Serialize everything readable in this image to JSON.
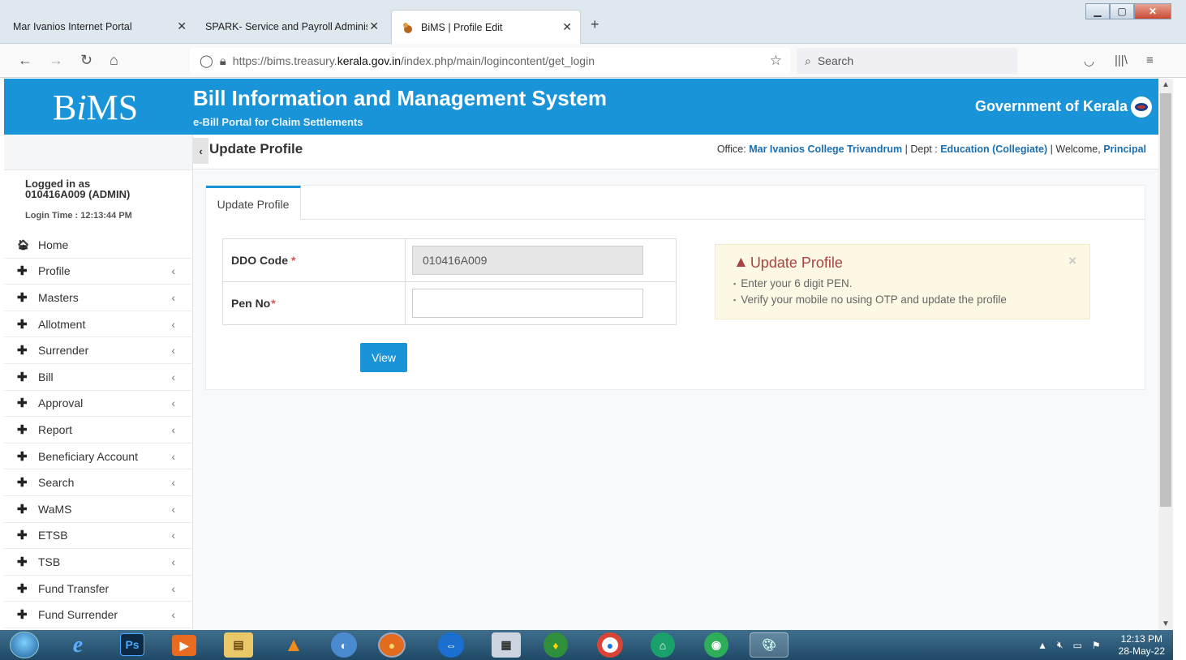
{
  "browser": {
    "tabs": [
      {
        "title": "Mar Ivanios Internet Portal",
        "active": false
      },
      {
        "title": "SPARK- Service and Payroll Adminis",
        "active": false
      },
      {
        "title": "BiMS | Profile Edit",
        "active": true
      }
    ],
    "url_prefix": "https://bims.treasury.",
    "url_domain": "kerala.gov.in",
    "url_path": "/index.php/main/logincontent/get_login",
    "search_placeholder": "Search"
  },
  "header": {
    "logo_b": "B",
    "logo_i": "i",
    "logo_ms": "MS",
    "title": "Bill Information and Management System",
    "subtitle": "e-Bill Portal for Claim Settlements",
    "gov": "Government of Kerala"
  },
  "user": {
    "logged_in_label": "Logged in as",
    "logged_in_id": "010416A009 (ADMIN)",
    "login_time": "Login Time : 12:13:44 PM"
  },
  "sidebar": {
    "items": [
      {
        "label": "Home",
        "icon": "home-icon",
        "has_sub": false
      },
      {
        "label": "Profile",
        "icon": "plus-icon",
        "has_sub": true
      },
      {
        "label": "Masters",
        "icon": "plus-icon",
        "has_sub": true
      },
      {
        "label": "Allotment",
        "icon": "plus-icon",
        "has_sub": true
      },
      {
        "label": "Surrender",
        "icon": "plus-icon",
        "has_sub": true
      },
      {
        "label": "Bill",
        "icon": "plus-icon",
        "has_sub": true
      },
      {
        "label": "Approval",
        "icon": "plus-icon",
        "has_sub": true
      },
      {
        "label": "Report",
        "icon": "plus-icon",
        "has_sub": true
      },
      {
        "label": "Beneficiary Account",
        "icon": "plus-icon",
        "has_sub": true
      },
      {
        "label": "Search",
        "icon": "plus-icon",
        "has_sub": true
      },
      {
        "label": "WaMS",
        "icon": "plus-icon",
        "has_sub": true
      },
      {
        "label": "ETSB",
        "icon": "plus-icon",
        "has_sub": true
      },
      {
        "label": "TSB",
        "icon": "plus-icon",
        "has_sub": true
      },
      {
        "label": "Fund Transfer",
        "icon": "plus-icon",
        "has_sub": true
      },
      {
        "label": "Fund Surrender",
        "icon": "plus-icon",
        "has_sub": true
      }
    ]
  },
  "crumb": {
    "page_title": "Update Profile",
    "office_label": "Office:",
    "office_value": "Mar Ivanios College Trivandrum",
    "dept_label": "| Dept :",
    "dept_value": "Education (Collegiate)",
    "welcome_label": "| Welcome,",
    "welcome_value": "Principal"
  },
  "form": {
    "tab_label": "Update Profile",
    "ddo_label": "DDO Code",
    "ddo_value": "010416A009",
    "pen_label": "Pen No",
    "pen_value": "",
    "required_mark": "*",
    "view_button": "View"
  },
  "alert": {
    "title": "Update Profile",
    "items": [
      "Enter your 6 digit PEN.",
      "Verify your mobile no using OTP and update the profile"
    ]
  },
  "taskbar": {
    "time": "12:13 PM",
    "date": "28-May-22"
  },
  "colors": {
    "brand": "#1a94d8",
    "alert_bg": "#fcf8e3",
    "alert_text": "#a94442",
    "required": "#d9534f"
  }
}
